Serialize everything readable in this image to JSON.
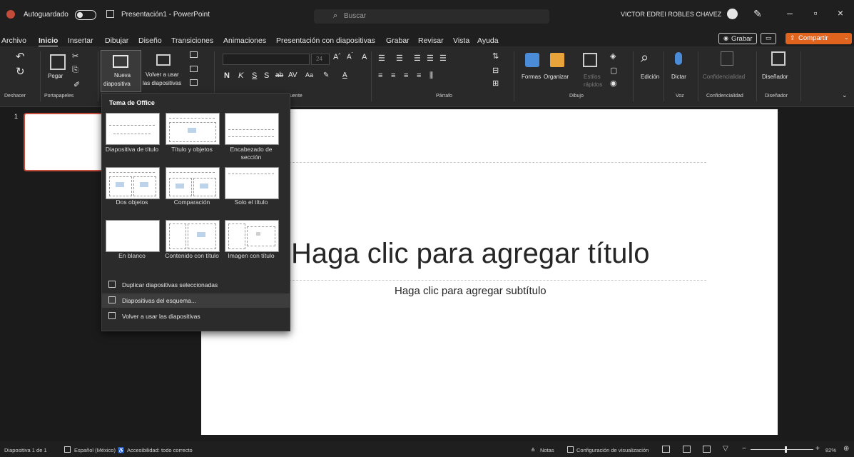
{
  "titlebar": {
    "autosave_label": "Autoguardado",
    "file_name": "Presentación1 - PowerPoint",
    "search_placeholder": "Buscar",
    "user_name": "VICTOR EDREI ROBLES CHAVEZ"
  },
  "menu": {
    "tabs": [
      "Archivo",
      "Inicio",
      "Insertar",
      "Dibujar",
      "Diseño",
      "Transiciones",
      "Animaciones",
      "Presentación con diapositivas",
      "Grabar",
      "Revisar",
      "Vista",
      "Ayuda"
    ],
    "active": "Inicio",
    "record_label": "Grabar",
    "share_label": "Compartir"
  },
  "ribbon": {
    "paste_label": "Pegar",
    "new_slide_label": "Nueva",
    "new_slide_label2": "diapositiva",
    "reuse_label": "Volver a usar",
    "reuse_label2": "las diapositivas",
    "font_size": "24",
    "shapes_label": "Formas",
    "arrange_label": "Organizar",
    "quick_styles_label": "Estilos",
    "quick_styles_label2": "rápidos",
    "editing_label": "Edición",
    "dictate_label": "Dictar",
    "sensitivity_label": "Confidencialidad",
    "designer_label": "Diseñador",
    "groups": {
      "undo": "Deshacer",
      "clipboard": "Portapapeles",
      "font": "Fuente",
      "paragraph": "Párrafo",
      "drawing": "Dibujo",
      "voice": "Voz",
      "sensitivity": "Confidencialidad",
      "designer": "Diseñador"
    }
  },
  "thumbnails": {
    "slide_number": "1"
  },
  "slide": {
    "title_placeholder": "Haga clic para agregar título",
    "subtitle_placeholder": "Haga clic para agregar subtítulo"
  },
  "dropdown": {
    "header": "Tema de Office",
    "layouts": [
      {
        "label": "Diapositiva de título"
      },
      {
        "label": "Título y objetos"
      },
      {
        "label": "Encabezado de sección"
      },
      {
        "label": "Dos objetos"
      },
      {
        "label": "Comparación"
      },
      {
        "label": "Solo el título"
      },
      {
        "label": "En blanco"
      },
      {
        "label": "Contenido con título"
      },
      {
        "label": "Imagen con título"
      }
    ],
    "commands": {
      "duplicate": "Duplicar diapositivas seleccionadas",
      "outline": "Diapositivas del esquema...",
      "reuse": "Volver a usar las diapositivas"
    }
  },
  "statusbar": {
    "slide_counter": "Diapositiva 1 de 1",
    "language": "Español (México)",
    "accessibility": "Accesibilidad: todo correcto",
    "notes": "Notas",
    "display_settings": "Configuración de visualización",
    "zoom": "82%"
  },
  "colors": {
    "accent": "#c44b3a",
    "share_button": "#e0641e",
    "background": "#1f1f1f"
  }
}
